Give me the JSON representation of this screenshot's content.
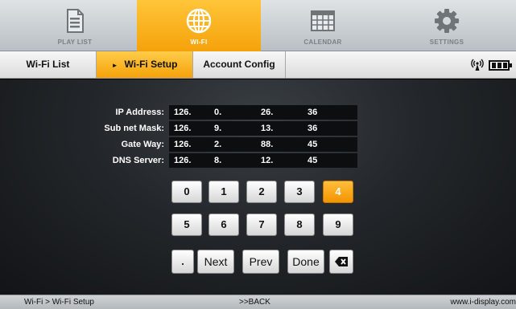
{
  "nav": {
    "items": [
      {
        "label": "PLAY LIST",
        "icon": "document-icon"
      },
      {
        "label": "WI-FI",
        "icon": "globe-icon"
      },
      {
        "label": "CALENDAR",
        "icon": "calendar-icon"
      },
      {
        "label": "SETTINGS",
        "icon": "gear-icon"
      }
    ],
    "active_index": 1
  },
  "subtabs": {
    "items": [
      {
        "label": "Wi-Fi List"
      },
      {
        "label": "Wi-Fi Setup"
      },
      {
        "label": "Account Config"
      }
    ],
    "active_index": 1
  },
  "status": {
    "wifi_icon": "wifi-signal-icon",
    "battery_icon": "battery-icon"
  },
  "network": {
    "rows": [
      {
        "label": "IP Address:",
        "octets": [
          "126.",
          "0.",
          "26.",
          "36"
        ]
      },
      {
        "label": "Sub net Mask:",
        "octets": [
          "126.",
          "9.",
          "13.",
          "36"
        ]
      },
      {
        "label": "Gate Way:",
        "octets": [
          "126.",
          "2.",
          "88.",
          "45"
        ]
      },
      {
        "label": "DNS Server:",
        "octets": [
          "126.",
          "8.",
          "12.",
          "45"
        ]
      }
    ]
  },
  "keypad": {
    "row1": [
      "0",
      "1",
      "2",
      "3",
      "4"
    ],
    "row2": [
      "5",
      "6",
      "7",
      "8",
      "9"
    ],
    "row3": [
      ".",
      "Next",
      "Prev",
      "Done"
    ],
    "active_key": "4",
    "backspace_icon": "backspace-icon"
  },
  "footer": {
    "breadcrumb": "Wi-Fi > Wi-Fi Setup",
    "back": ">>BACK",
    "site": "www.i-display.com"
  },
  "colors": {
    "accent": "#f5a20a",
    "nav_bg": "#c8cdd1",
    "panel_bg": "#23272b"
  }
}
